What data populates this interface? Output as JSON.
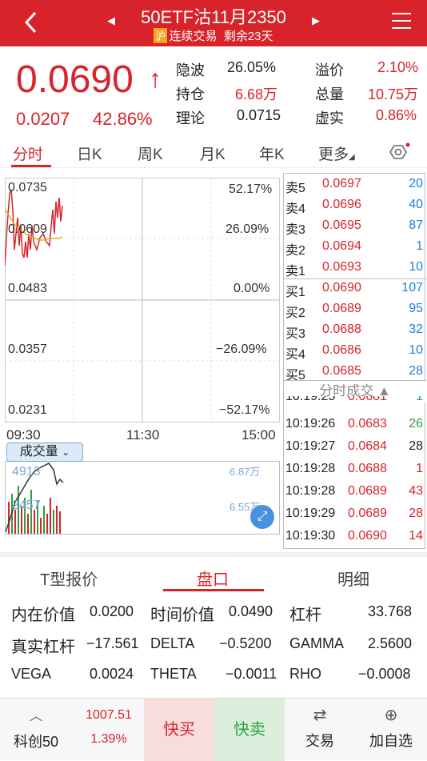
{
  "header": {
    "title": "50ETF沽11月2350",
    "exchange_tag": "沪",
    "trade_status": "连续交易",
    "days_left": "剩余23天"
  },
  "quote": {
    "price": "0.0690",
    "change": "0.0207",
    "change_pct": "42.86%",
    "fields": [
      {
        "label": "隐波",
        "value": "26.05%"
      },
      {
        "label": "溢价",
        "value": "2.10%"
      },
      {
        "label": "持仓",
        "value": "6.68万"
      },
      {
        "label": "总量",
        "value": "10.75万"
      },
      {
        "label": "理论",
        "value": "0.0715"
      },
      {
        "label": "虚实",
        "value": "0.86%"
      }
    ]
  },
  "chart_tabs": [
    "分时",
    "日K",
    "周K",
    "月K",
    "年K",
    "更多"
  ],
  "chart": {
    "price_levels": [
      "0.0735",
      "0.0609",
      "0.0483",
      "0.0357",
      "0.0231"
    ],
    "pct_levels": [
      "52.17%",
      "26.09%",
      "0.00%",
      "−26.09%",
      "−52.17%"
    ],
    "times": [
      "09:30",
      "11:30",
      "15:00"
    ],
    "volume_selector": "成交量",
    "vol_levels": [
      "4913",
      "2457"
    ],
    "vol_right": [
      "6.87万",
      "6.55万"
    ]
  },
  "order_book": {
    "asks": [
      {
        "label": "卖5",
        "price": "0.0697",
        "vol": "20"
      },
      {
        "label": "卖4",
        "price": "0.0696",
        "vol": "40"
      },
      {
        "label": "卖3",
        "price": "0.0695",
        "vol": "87"
      },
      {
        "label": "卖2",
        "price": "0.0694",
        "vol": "1"
      },
      {
        "label": "卖1",
        "price": "0.0693",
        "vol": "10"
      }
    ],
    "bids": [
      {
        "label": "买1",
        "price": "0.0690",
        "vol": "107"
      },
      {
        "label": "买2",
        "price": "0.0689",
        "vol": "95"
      },
      {
        "label": "买3",
        "price": "0.0688",
        "vol": "32"
      },
      {
        "label": "买4",
        "price": "0.0686",
        "vol": "10"
      },
      {
        "label": "买5",
        "price": "0.0685",
        "vol": "28"
      }
    ],
    "trades_title": "分时成交",
    "trades": [
      {
        "time": "10:19:25",
        "price": "0.0681",
        "vol": "1"
      },
      {
        "time": "10:19:26",
        "price": "0.0683",
        "vol": "26"
      },
      {
        "time": "10:19:27",
        "price": "0.0684",
        "vol": "28"
      },
      {
        "time": "10:19:28",
        "price": "0.0688",
        "vol": "1"
      },
      {
        "time": "10:19:28",
        "price": "0.0689",
        "vol": "43"
      },
      {
        "time": "10:19:29",
        "price": "0.0689",
        "vol": "28"
      },
      {
        "time": "10:19:30",
        "price": "0.0690",
        "vol": "14"
      }
    ]
  },
  "bottom_tabs": [
    "T型报价",
    "盘口",
    "明细"
  ],
  "greeks": [
    {
      "label": "内在价值",
      "value": "0.0200"
    },
    {
      "label": "时间价值",
      "value": "0.0490"
    },
    {
      "label": "杠杆",
      "value": "33.768"
    },
    {
      "label": "真实杠杆",
      "value": "−17.561"
    },
    {
      "label": "DELTA",
      "value": "−0.5200"
    },
    {
      "label": "GAMMA",
      "value": "2.5600"
    },
    {
      "label": "VEGA",
      "value": "0.0024"
    },
    {
      "label": "THETA",
      "value": "−0.0011"
    },
    {
      "label": "RHO",
      "value": "−0.0008"
    }
  ],
  "footer": {
    "index_name": "科创50",
    "index_value": "1007.51",
    "index_pct": "1.39%",
    "buy": "快买",
    "sell": "快卖",
    "trade": "交易",
    "add_watch": "加自选"
  }
}
